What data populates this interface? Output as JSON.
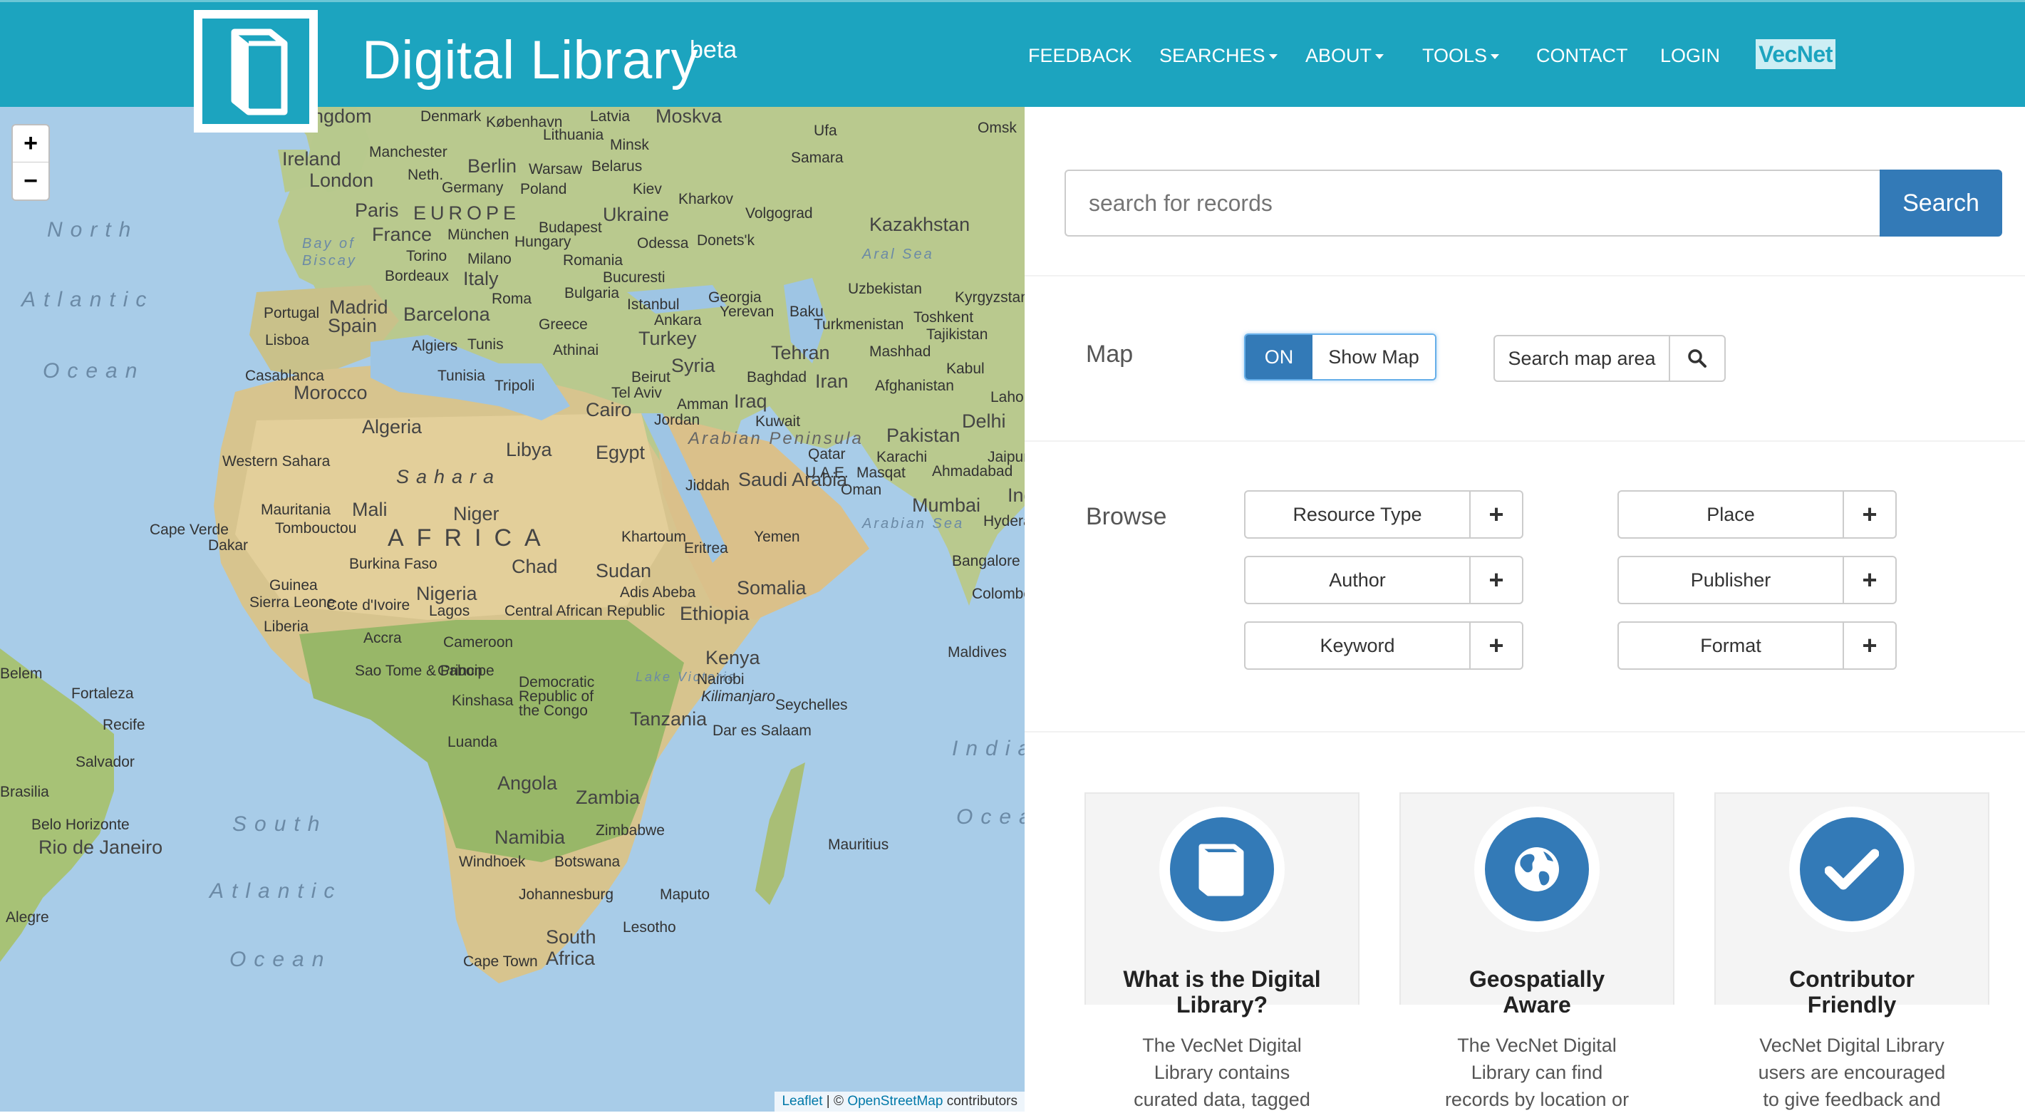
{
  "header": {
    "brand": "Digital Library",
    "beta": "beta",
    "nav": [
      {
        "label": "FEEDBACK",
        "dropdown": false
      },
      {
        "label": "SEARCHES",
        "dropdown": true
      },
      {
        "label": "ABOUT",
        "dropdown": true
      },
      {
        "label": "TOOLS",
        "dropdown": true
      },
      {
        "label": "CONTACT",
        "dropdown": false
      },
      {
        "label": "LOGIN",
        "dropdown": false
      }
    ],
    "vecnet_label": "VecNet"
  },
  "map": {
    "zoom_in": "+",
    "zoom_out": "−",
    "attribution": {
      "leaflet": "Leaflet",
      "sep": " | © ",
      "osm": "OpenStreetMap",
      "contributors": " contributors"
    },
    "labels": [
      "Kingdom",
      "Ireland",
      "London",
      "Manchester",
      "Berlin",
      "Warsaw",
      "Belarus",
      "Lithuania",
      "Latvia",
      "Moskva",
      "Denmark",
      "København",
      "Minsk",
      "Neth.",
      "Germany",
      "Poland",
      "Kiev",
      "Ufa",
      "Samara",
      "Omsk",
      "Kharkov",
      "Paris",
      "EUROPE",
      "France",
      "München",
      "Hungary",
      "Ukraine",
      "Volgograd",
      "Kazakhstan",
      "Budapest",
      "Odessa",
      "Donets'k",
      "Bordeaux",
      "Torino",
      "Milano",
      "Italy",
      "Romania",
      "Bucuresti",
      "Bulgaria",
      "Roma",
      "Istanbul",
      "Aral Sea",
      "Uzbekistan",
      "Kyrgyzstan",
      "Georgia",
      "Yerevan",
      "Baku",
      "Turkmenistan",
      "Toshkent",
      "Tajikistan",
      "Portugal",
      "Madrid",
      "Spain",
      "Barcelona",
      "Greece",
      "Ankara",
      "Turkey",
      "Lisboa",
      "Algiers",
      "Tunis",
      "Athinai",
      "Syria",
      "Tehran",
      "Mashhad",
      "Kabul",
      "Casablanca",
      "Morocco",
      "Tunisia",
      "Tripoli",
      "Beirut",
      "Tel Aviv",
      "Baghdad",
      "Iran",
      "Afghanistan",
      "Lahore",
      "Cairo",
      "Amman",
      "Jordan",
      "Iraq",
      "Kuwait",
      "Pakistan",
      "Delhi",
      "Algeria",
      "Libya",
      "Egypt",
      "Arabian Peninsula",
      "Qatar",
      "Karachi",
      "Jaipur",
      "Western Sahara",
      "Sahara",
      "Saudi Arabia",
      "U.A.E.",
      "Masqat",
      "Ahmadabad",
      "Jiddah",
      "Oman",
      "Mauritania",
      "Mali",
      "Niger",
      "Mumbai",
      "India",
      "Tombouctou",
      "AFRICA",
      "Khartoum",
      "Yemen",
      "Hyderabad",
      "Cape Verde",
      "Dakar",
      "Chad",
      "Sudan",
      "Eritrea",
      "Arabian Sea",
      "Burkina Faso",
      "Guinea",
      "Nigeria",
      "Adis Abeba",
      "Somalia",
      "Bangalore",
      "Sierra Leone",
      "Cote d'Ivoire",
      "Lagos",
      "Central African Republic",
      "Ethiopia",
      "Colombo",
      "Liberia",
      "Accra",
      "Cameroon",
      "Maldives",
      "Kenya",
      "Sao Tome & Principe",
      "Gabon",
      "Democratic Republic of the Congo",
      "Lake Victoria",
      "Nairobi",
      "Kilimanjaro",
      "Kinshasa",
      "Seychelles",
      "Tanzania",
      "Dar es Salaam",
      "Luanda",
      "Angola",
      "Zambia",
      "Namibia",
      "Zimbabwe",
      "Mauritius",
      "Windhoek",
      "Botswana",
      "Johannesburg",
      "Maputo",
      "South Africa",
      "Lesotho",
      "Cape Town",
      "Fortaleza",
      "Recife",
      "Salvador",
      "Brasilia",
      "Belo Horizonte",
      "Rio de Janeiro",
      "Alegre",
      "Belem",
      "North",
      "Atlantic",
      "Ocean",
      "South",
      "Bay of Biscay",
      "Indian",
      "Ocea"
    ]
  },
  "search": {
    "placeholder": "search for records",
    "button": "Search"
  },
  "map_section": {
    "label": "Map",
    "toggle_on": "ON",
    "toggle_text": "Show Map",
    "area_search": "Search map area"
  },
  "browse": {
    "label": "Browse",
    "items": [
      {
        "label": "Resource Type",
        "plus": "+"
      },
      {
        "label": "Place",
        "plus": "+"
      },
      {
        "label": "Author",
        "plus": "+"
      },
      {
        "label": "Publisher",
        "plus": "+"
      },
      {
        "label": "Keyword",
        "plus": "+"
      },
      {
        "label": "Format",
        "plus": "+"
      }
    ]
  },
  "features": [
    {
      "title_l1": "What is the Digital",
      "title_l2": "Library?",
      "text": [
        "The VecNet Digital",
        "Library contains",
        "curated data, tagged"
      ],
      "icon": "book-icon"
    },
    {
      "title_l1": "Geospatially",
      "title_l2": "Aware",
      "text": [
        "The VecNet Digital",
        "Library can find",
        "records by location or"
      ],
      "icon": "globe-icon"
    },
    {
      "title_l1": "Contributor",
      "title_l2": "Friendly",
      "text": [
        "VecNet Digital Library",
        "users are encouraged",
        "to give feedback and"
      ],
      "icon": "check-icon"
    }
  ],
  "colors": {
    "navbar": "#1ca4bf",
    "primary": "#337ab7",
    "vecnet_bg": "#cdeef4"
  }
}
